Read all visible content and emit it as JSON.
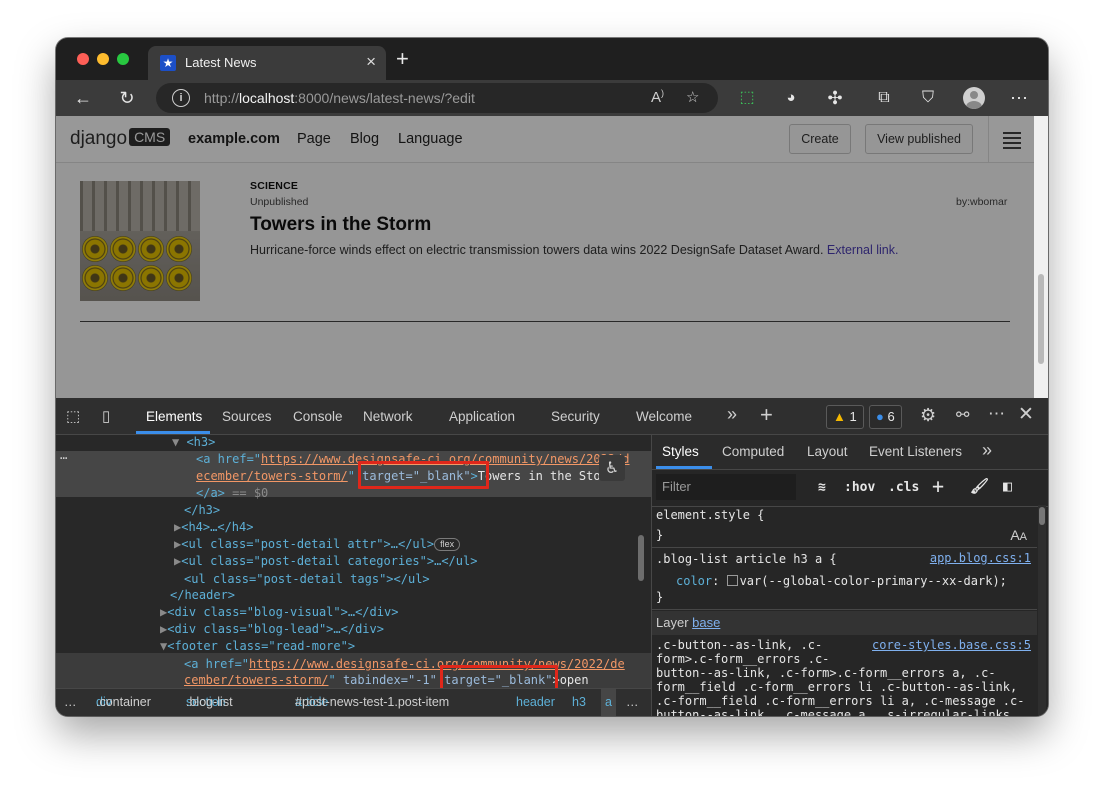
{
  "browser": {
    "tab_title": "Latest News",
    "tab_close": "×",
    "new_tab": "+",
    "url_prefix": "http://",
    "url_host": "localhost",
    "url_rest": ":8000/news/latest-news/?edit"
  },
  "cms": {
    "logo_text": "django",
    "logo_badge": "CMS",
    "site": "example.com",
    "nav": [
      "Page",
      "Blog",
      "Language"
    ],
    "create": "Create",
    "view_published": "View published"
  },
  "post": {
    "category": "SCIENCE",
    "status": "Unpublished",
    "byline": "by:wbomar",
    "title": "Towers in the Storm",
    "lead": "Hurricane-force winds effect on electric transmission towers data wins 2022 DesignSafe Dataset Award.",
    "link": "External link."
  },
  "devtools": {
    "tabs": [
      "Elements",
      "Sources",
      "Console",
      "Network",
      "Application",
      "Security",
      "Welcome"
    ],
    "warnings": "1",
    "issues": "6",
    "dom": {
      "l1": "<h3>",
      "l2_a": "<a href=\"",
      "l2_url": "https://www.designsafe-ci.org/community/news/2022/d",
      "l3_url": "ecember/towers-storm/",
      "l3_target": "target=\"_blank\"",
      "l3_text": "Towers in the Sto",
      "l4": "</a>",
      "l4_eq": "== $0",
      "l5": "</h3>",
      "l6": "<h4>…</h4>",
      "l7": "<ul class=\"post-detail attr\">…</ul>",
      "flex": "flex",
      "l8": "<ul class=\"post-detail categories\">…</ul>",
      "l9": "<ul class=\"post-detail tags\"></ul>",
      "l10": "</header>",
      "l11": "<div class=\"blog-visual\">…</div>",
      "l12": "<div class=\"blog-lead\">…</div>",
      "l13": "<footer class=\"read-more\">",
      "l14_a": "<a href=\"",
      "l14_url": "https://www.designsafe-ci.org/community/news/2022/de",
      "l15_url": "cember/towers-storm/",
      "l15_tabindex": "tabindex=\"-1\"",
      "l15_target": "target=\"_blank\"",
      "l15_text": ">open"
    },
    "breadcrumbs": [
      "…",
      "div.container",
      "section.blog-list",
      "article#post-news-test-1.post-item",
      "header",
      "h3",
      "a",
      "…"
    ],
    "styles_tabs": [
      "Styles",
      "Computed",
      "Layout",
      "Event Listeners"
    ],
    "filter_placeholder": "Filter",
    "hov": ":hov",
    "cls": ".cls",
    "rules": {
      "element_style": "element.style {",
      "close": "}",
      "blog_selector": ".blog-list article h3 a {",
      "blog_source": "app.blog.css:1",
      "blog_prop": "color",
      "blog_value": "var(--global-color-primary--xx-dark);",
      "layer_label": "Layer",
      "layer_link": "base",
      "core_source": "core-styles.base.css:5",
      "core_lines": [
        ".c-button--as-link, .c-",
        "form>.c-form__errors .c-",
        "button--as-link, .c-form>.c-form__errors a, .c-",
        "form__field .c-form__errors li .c-button--as-link,",
        ".c-form__field .c-form__errors li a, .c-message .c-",
        "button--as-link, .c-message a, .s-irregular-links"
      ]
    }
  }
}
